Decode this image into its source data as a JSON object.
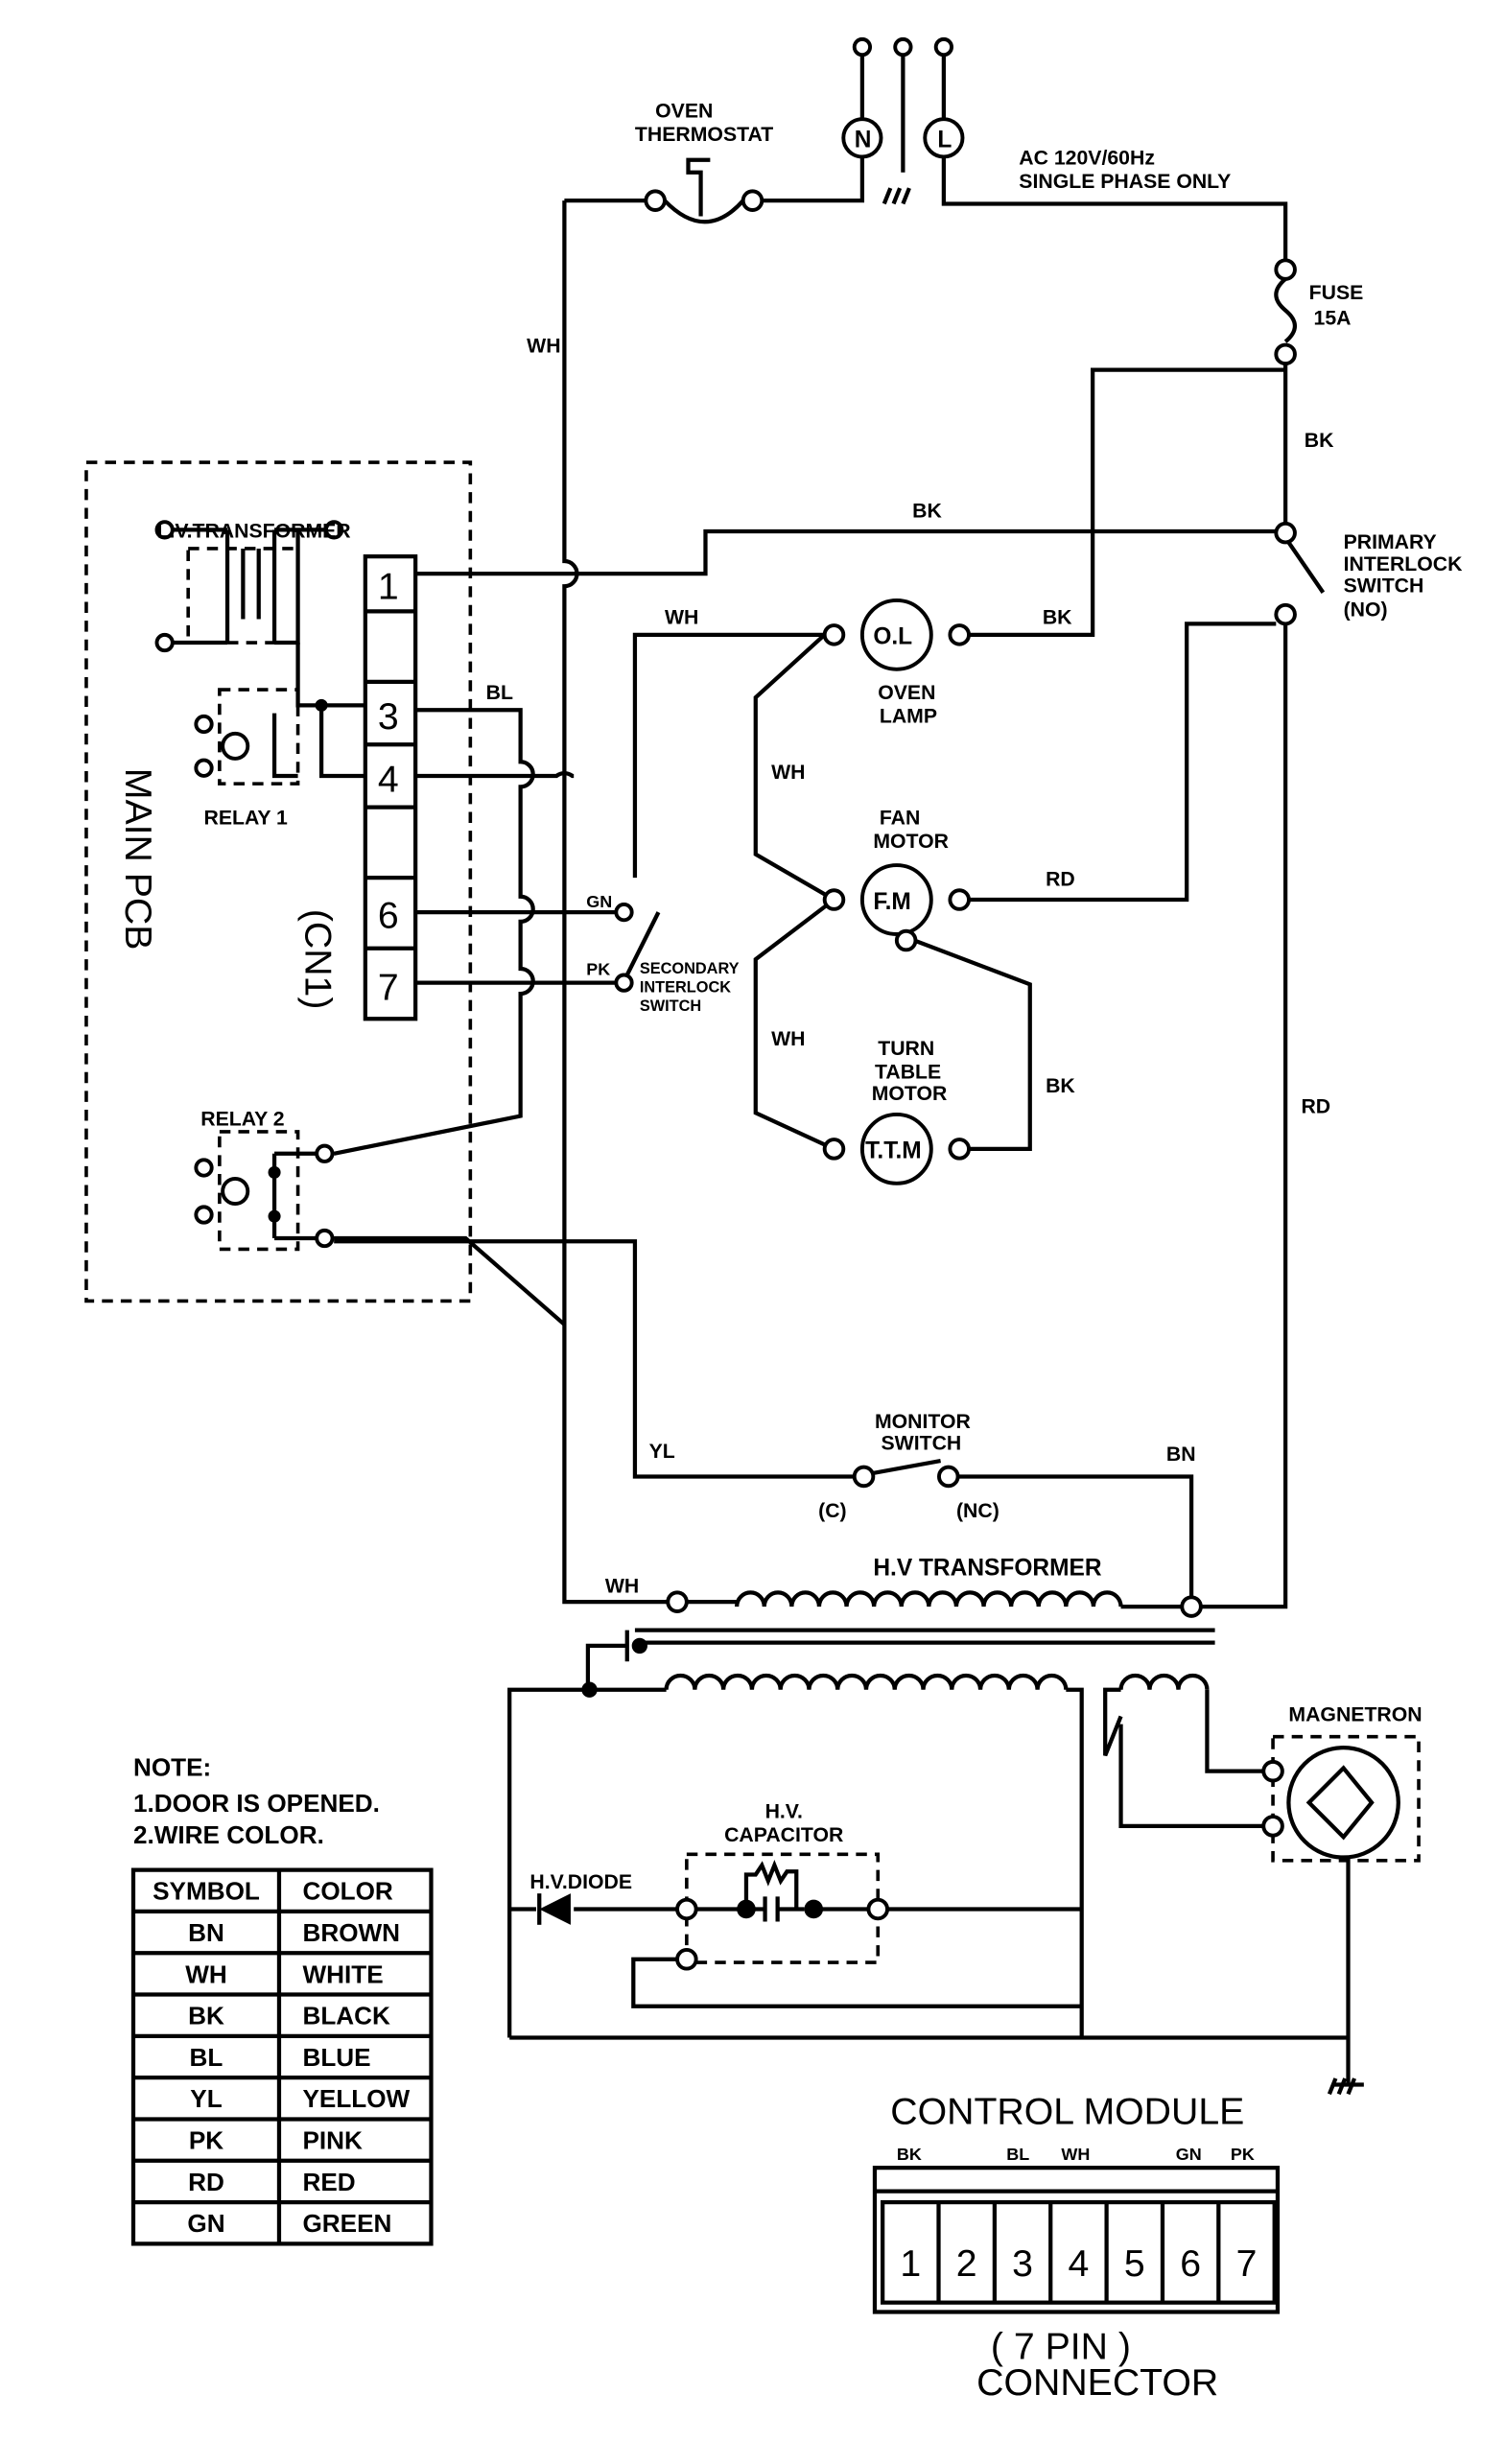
{
  "labels": {
    "oven_thermostat": [
      "OVEN",
      "THERMOSTAT"
    ],
    "neutral": "N",
    "live": "L",
    "power": [
      "AC 120V/60Hz",
      "SINGLE PHASE ONLY"
    ],
    "fuse": [
      "FUSE",
      "15A"
    ],
    "primary_switch": [
      "PRIMARY",
      "INTERLOCK",
      "SWITCH",
      "(NO)"
    ],
    "lv_transformer": "L.V.TRANSFORMER",
    "relay1": "RELAY 1",
    "relay2": "RELAY 2",
    "main_pcb": "MAIN PCB",
    "cn1": "(CN1)",
    "cn1_pins": [
      "1",
      "3",
      "4",
      "6",
      "7"
    ],
    "oven_lamp_symbol": "O.L",
    "oven_lamp": [
      "OVEN",
      "LAMP"
    ],
    "fan_motor_symbol": "F.M",
    "fan_motor": [
      "FAN",
      "MOTOR"
    ],
    "ttm_symbol": "T.T.M",
    "turntable_motor": [
      "TURN",
      "TABLE",
      "MOTOR"
    ],
    "secondary_switch": [
      "SECONDARY",
      "INTERLOCK",
      "SWITCH"
    ],
    "monitor_switch": [
      "MONITOR",
      "SWITCH"
    ],
    "monitor_c": "(C)",
    "monitor_nc": "(NC)",
    "hv_transformer": "H.V TRANSFORMER",
    "hv_capacitor": [
      "H.V.",
      "CAPACITOR"
    ],
    "hv_diode": "H.V.DIODE",
    "magnetron": "MAGNETRON",
    "wires": {
      "wh1": "WH",
      "bk1": "BK",
      "bk2": "BK",
      "wh2": "WH",
      "bk3": "BK",
      "bl": "BL",
      "wh3": "WH",
      "rd1": "RD",
      "gn": "GN",
      "pk": "PK",
      "wh4": "WH",
      "bk4": "BK",
      "rd2": "RD",
      "yl": "YL",
      "bn": "BN",
      "wh5": "WH"
    }
  },
  "note": {
    "title": "NOTE:",
    "items": [
      "1.DOOR IS OPENED.",
      "2.WIRE COLOR."
    ]
  },
  "color_table": {
    "headers": [
      "SYMBOL",
      "COLOR"
    ],
    "rows": [
      [
        "BN",
        "BROWN"
      ],
      [
        "WH",
        "WHITE"
      ],
      [
        "BK",
        "BLACK"
      ],
      [
        "BL",
        "BLUE"
      ],
      [
        "YL",
        "YELLOW"
      ],
      [
        "PK",
        "PINK"
      ],
      [
        "RD",
        "RED"
      ],
      [
        "GN",
        "GREEN"
      ]
    ]
  },
  "control_module": {
    "title": "CONTROL MODULE",
    "wire_labels": [
      "BK",
      "BL",
      "WH",
      "GN",
      "PK"
    ],
    "pins": [
      "1",
      "2",
      "3",
      "4",
      "5",
      "6",
      "7"
    ],
    "caption": [
      "( 7 PIN )",
      "CONNECTOR"
    ]
  }
}
